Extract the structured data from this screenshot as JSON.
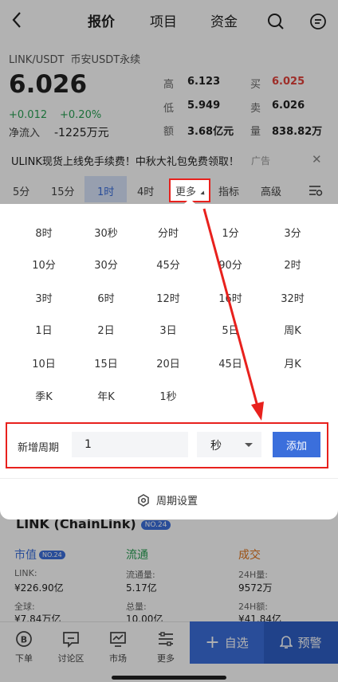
{
  "nav": {
    "back_icon": "back-chevron-icon",
    "tabs": [
      "报价",
      "项目",
      "资金"
    ],
    "active_tab": "报价"
  },
  "ticker": {
    "symbol": "LINK/USDT",
    "exchange": "币安USDT永续",
    "price": "6.026",
    "change": "+0.012",
    "change_pct": "+0.20%",
    "inflow_label": "净流入",
    "inflow_value": "-1225万元"
  },
  "stats": [
    {
      "label": "高",
      "value": "6.123",
      "color": "normal"
    },
    {
      "label": "低",
      "value": "5.949",
      "color": "normal"
    },
    {
      "label": "额",
      "value": "3.68亿元",
      "color": "normal"
    },
    {
      "label": "买",
      "value": "6.025",
      "color": "red"
    },
    {
      "label": "卖",
      "value": "6.026",
      "color": "normal"
    },
    {
      "label": "量",
      "value": "838.82万",
      "color": "normal"
    }
  ],
  "banner": {
    "text": "ULINK现货上线免手续费！中秋大礼包免费领取！",
    "ad": "广告",
    "close": "✕"
  },
  "periods": {
    "items": [
      "5分",
      "15分",
      "1时",
      "4时",
      "更多",
      "指标",
      "高级"
    ],
    "active": "1时"
  },
  "popup": {
    "options": [
      [
        "8时",
        "30秒",
        "分时",
        "1分",
        "3分"
      ],
      [
        "10分",
        "30分",
        "45分",
        "90分",
        "2时"
      ],
      [
        "3时",
        "6时",
        "12时",
        "16时",
        "32时"
      ],
      [
        "1日",
        "2日",
        "3日",
        "5日",
        "周K"
      ],
      [
        "10日",
        "15日",
        "20日",
        "45日",
        "月K"
      ],
      [
        "季K",
        "年K",
        "1秒"
      ]
    ],
    "add_label": "新增周期",
    "add_value": "1",
    "unit": "秒",
    "add_button": "添加",
    "settings_label": "周期设置"
  },
  "coin": {
    "title": "LINK (ChainLink)",
    "badge": "NO.24",
    "columns": [
      {
        "header": "市值",
        "badge": "NO.24",
        "color": "blue",
        "rows": [
          [
            "LINK:",
            "¥226.90亿"
          ],
          [
            "全球:",
            "¥7.84万亿"
          ]
        ]
      },
      {
        "header": "流通",
        "badge": "",
        "color": "green",
        "rows": [
          [
            "流通量:",
            "5.17亿"
          ],
          [
            "总量:",
            "10.00亿"
          ]
        ]
      },
      {
        "header": "成交",
        "badge": "",
        "color": "orange",
        "rows": [
          [
            "24H量:",
            "9572万"
          ],
          [
            "24H额:",
            "¥41.84亿"
          ]
        ]
      }
    ]
  },
  "bottom": {
    "items": [
      {
        "label": "下单",
        "icon": "bitcoin-order-icon"
      },
      {
        "label": "讨论区",
        "icon": "chat-icon"
      },
      {
        "label": "市场",
        "icon": "market-chart-icon"
      },
      {
        "label": "更多",
        "icon": "more-sliders-icon"
      }
    ],
    "favorite": "自选",
    "alert": "预警"
  }
}
